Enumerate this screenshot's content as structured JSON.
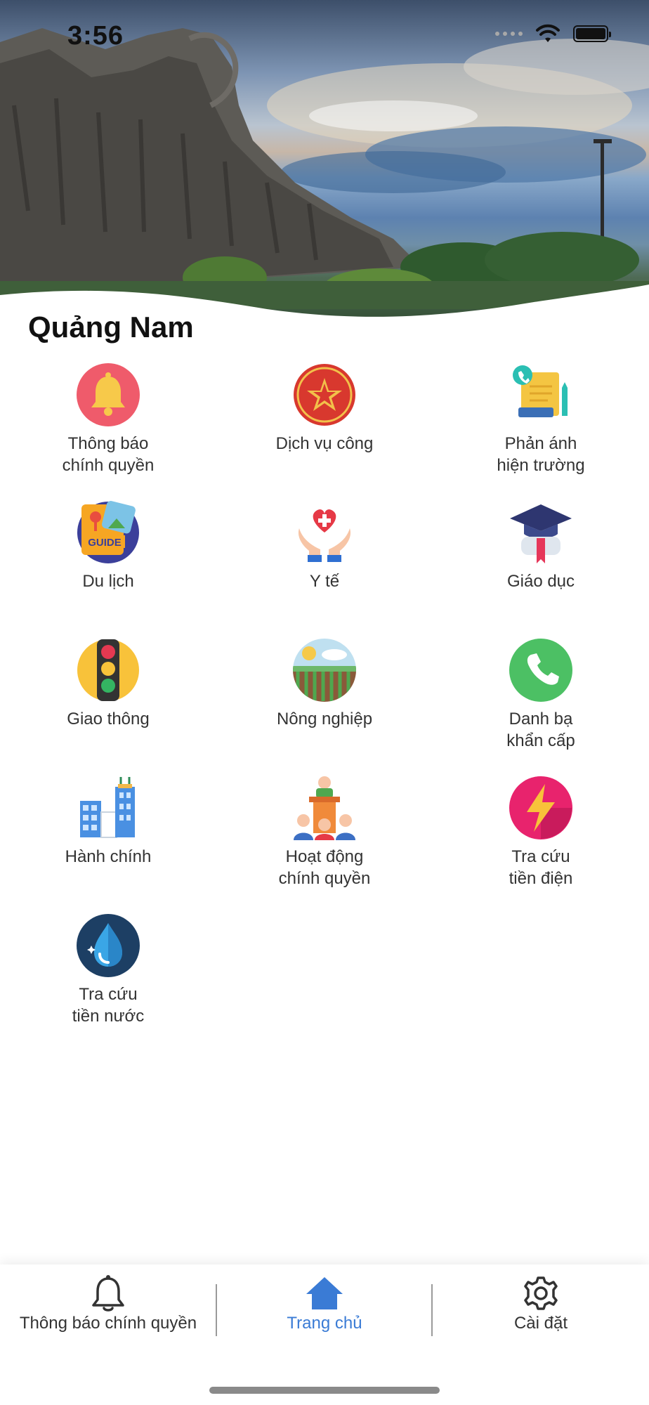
{
  "status_bar": {
    "time": "3:56"
  },
  "page": {
    "title": "Quảng Nam"
  },
  "grid": [
    {
      "label": "Thông báo\nchính quyền",
      "icon": "bell-icon"
    },
    {
      "label": "Dịch vụ công",
      "icon": "public-service-emblem-icon"
    },
    {
      "label": "Phản ánh\nhiện trường",
      "icon": "feedback-report-icon"
    },
    {
      "label": "Du lịch",
      "icon": "travel-guide-icon"
    },
    {
      "label": "Y tế",
      "icon": "health-hands-heart-icon"
    },
    {
      "label": "Giáo dục",
      "icon": "graduation-cap-icon"
    },
    {
      "label": "Giao thông",
      "icon": "traffic-light-icon"
    },
    {
      "label": "Nông nghiệp",
      "icon": "farm-field-icon"
    },
    {
      "label": "Danh bạ\nkhẩn cấp",
      "icon": "phone-icon"
    },
    {
      "label": "Hành chính",
      "icon": "office-buildings-icon"
    },
    {
      "label": "Hoạt động\nchính quyền",
      "icon": "government-podium-icon"
    },
    {
      "label": "Tra cứu\ntiền điện",
      "icon": "lightning-icon"
    },
    {
      "label": "Tra cứu\ntiền nước",
      "icon": "water-drop-icon"
    }
  ],
  "bottom_nav": {
    "notifications_label": "Thông báo chính quyền",
    "home_label": "Trang chủ",
    "settings_label": "Cài đặt",
    "active": "home",
    "accent_color": "#3a7bd5"
  }
}
